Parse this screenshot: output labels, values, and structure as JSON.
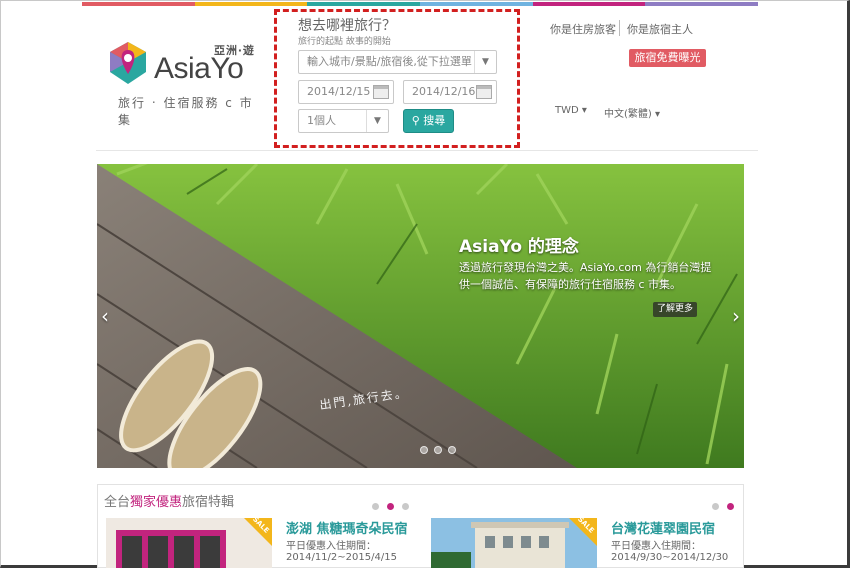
{
  "brand": {
    "region_label": "亞洲‧遊",
    "wordmark": "AsiaYo",
    "tagline": "旅行 ‧ 住宿服務 c 市集",
    "colors": [
      "#e15b63",
      "#2aa7a0",
      "#f3b61b",
      "#c2247e"
    ]
  },
  "search": {
    "title": "想去哪裡旅行？",
    "subtitle": "旅行的起點 故事的開始",
    "city_placeholder": "輸入城市/景點/旅宿後,從下拉選單",
    "checkin": "2014/12/15",
    "checkout": "2014/12/16",
    "guests": "1個人",
    "button": "搜尋"
  },
  "header": {
    "guest_link": "你是住房旅客",
    "host_link": "你是旅宿主人",
    "promo": "旅宿免費曝光",
    "currency": "TWD",
    "language": "中文(繁體)"
  },
  "hero": {
    "title": "AsiaYo 的理念",
    "text": "透過旅行發現台灣之美。AsiaYo.com 為行銷台灣提供一個誠信、有保障的旅行住宿服務 c 市集。",
    "more": "了解更多",
    "caption": "出門,旅行去。"
  },
  "deals": {
    "title_pre": "全台",
    "title_hl": "獨家優惠",
    "title_post": "旅宿特輯",
    "sale_label": "SALE",
    "cards": [
      {
        "name": "澎湖 焦糖瑪奇朵民宿",
        "sub": "平日優惠入住期間：",
        "date": "2014/11/2~2015/4/15"
      },
      {
        "name": "台灣花蓮翠園民宿",
        "sub": "平日優惠入住期間：",
        "date": "2014/9/30~2014/12/30"
      }
    ]
  }
}
